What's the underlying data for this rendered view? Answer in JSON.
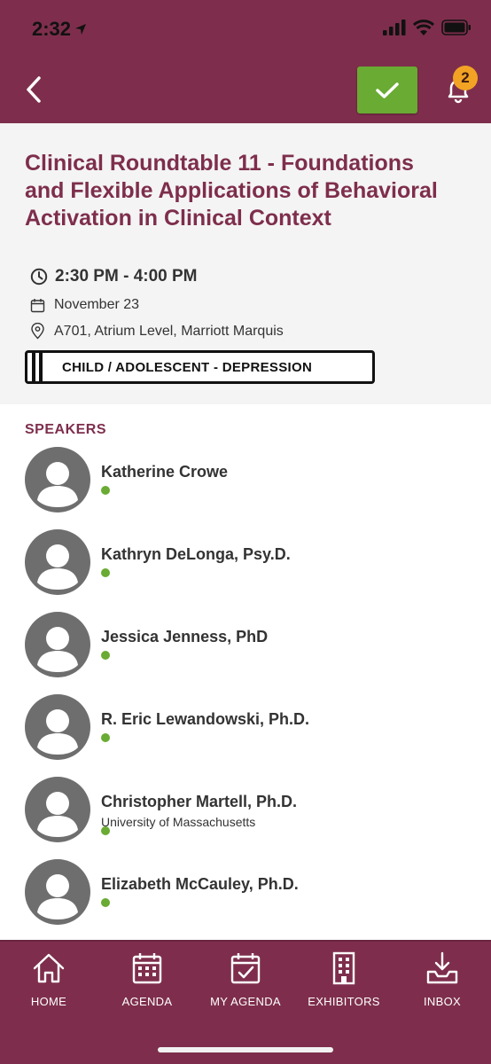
{
  "status_bar": {
    "time": "2:32"
  },
  "nav": {
    "notification_count": "2",
    "colors": {
      "brand": "#7e2e4c",
      "confirm": "#6aab33",
      "badge": "#f2a324"
    }
  },
  "session": {
    "title": "Clinical Roundtable 11 - Foundations and Flexible Applications of Behavioral Activation in Clinical Context",
    "time": "2:30 PM - 4:00 PM",
    "date": "November 23",
    "location": "A701, Atrium Level, Marriott Marquis",
    "tag": "CHILD / ADOLESCENT - DEPRESSION"
  },
  "speakers_heading": "SPEAKERS",
  "speakers": [
    {
      "name": "Katherine Crowe",
      "org": ""
    },
    {
      "name": "Kathryn DeLonga, Psy.D.",
      "org": ""
    },
    {
      "name": "Jessica Jenness, PhD",
      "org": ""
    },
    {
      "name": "R. Eric Lewandowski, Ph.D.",
      "org": ""
    },
    {
      "name": "Christopher Martell, Ph.D.",
      "org": "University of Massachusetts"
    },
    {
      "name": "Elizabeth McCauley, Ph.D.",
      "org": ""
    }
  ],
  "tabs": [
    {
      "label": "HOME",
      "icon": "home-icon"
    },
    {
      "label": "AGENDA",
      "icon": "calendar-icon"
    },
    {
      "label": "MY AGENDA",
      "icon": "calendar-check-icon"
    },
    {
      "label": "EXHIBITORS",
      "icon": "building-icon"
    },
    {
      "label": "INBOX",
      "icon": "inbox-icon"
    }
  ]
}
